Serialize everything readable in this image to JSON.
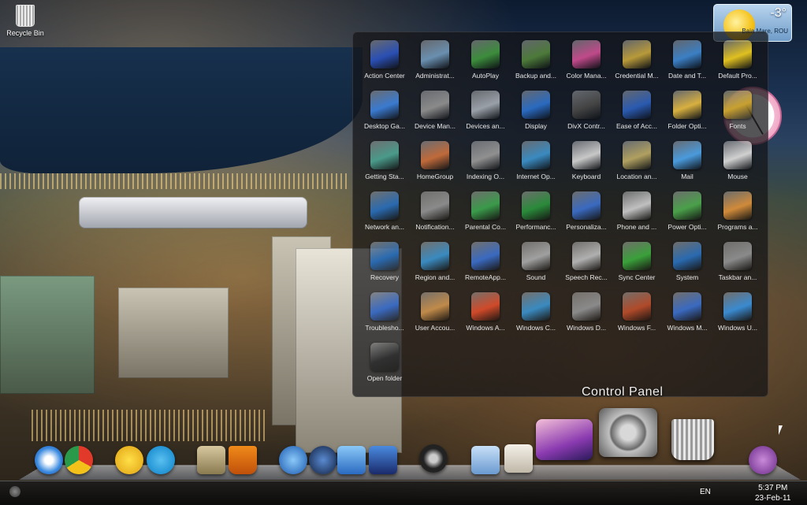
{
  "desktop": {
    "recycle_bin_label": "Recycle Bin"
  },
  "weather": {
    "temperature": "-3°",
    "location": "Baia Mare, ROU"
  },
  "control_panel": {
    "title": "Control Panel",
    "items": [
      {
        "label": "Action Center",
        "icon": "flag-icon",
        "color": "#2a4fb4"
      },
      {
        "label": "Administrat...",
        "icon": "folder-icon",
        "color": "#6a8fb0"
      },
      {
        "label": "AutoPlay",
        "icon": "autoplay-icon",
        "color": "#3c8c3c"
      },
      {
        "label": "Backup and...",
        "icon": "backup-icon",
        "color": "#4d7a3a"
      },
      {
        "label": "Color Mana...",
        "icon": "color-management-icon",
        "color": "#c04a8a"
      },
      {
        "label": "Credential M...",
        "icon": "vault-icon",
        "color": "#b89a3a"
      },
      {
        "label": "Date and T...",
        "icon": "calendar-clock-icon",
        "color": "#3b7fc4"
      },
      {
        "label": "Default Pro...",
        "icon": "default-programs-icon",
        "color": "#e0c020"
      },
      {
        "label": "Desktop Ga...",
        "icon": "gadgets-icon",
        "color": "#3a7ad0"
      },
      {
        "label": "Device Man...",
        "icon": "device-manager-icon",
        "color": "#8a8a8a"
      },
      {
        "label": "Devices an...",
        "icon": "printer-icon",
        "color": "#9aa0a8"
      },
      {
        "label": "Display",
        "icon": "monitor-icon",
        "color": "#2a6ac0"
      },
      {
        "label": "DivX Contr...",
        "icon": "divx-icon",
        "color": "#444444"
      },
      {
        "label": "Ease of Acc...",
        "icon": "accessibility-icon",
        "color": "#2a5ab0"
      },
      {
        "label": "Folder Opti...",
        "icon": "folder-options-icon",
        "color": "#d8b040"
      },
      {
        "label": "Fonts",
        "icon": "fonts-icon",
        "color": "#c8a030"
      },
      {
        "label": "Getting Sta...",
        "icon": "getting-started-icon",
        "color": "#4a9a8a"
      },
      {
        "label": "HomeGroup",
        "icon": "home-icon",
        "color": "#c06a3a"
      },
      {
        "label": "Indexing O...",
        "icon": "indexing-icon",
        "color": "#909090"
      },
      {
        "label": "Internet Op...",
        "icon": "globe-icon",
        "color": "#3a8ac0"
      },
      {
        "label": "Keyboard",
        "icon": "keyboard-icon",
        "color": "#c8c8c8"
      },
      {
        "label": "Location an...",
        "icon": "location-icon",
        "color": "#b0a060"
      },
      {
        "label": "Mail",
        "icon": "mail-icon",
        "color": "#4a9adc"
      },
      {
        "label": "Mouse",
        "icon": "mouse-icon",
        "color": "#d0d0d0"
      },
      {
        "label": "Network an...",
        "icon": "network-icon",
        "color": "#2a6ab0"
      },
      {
        "label": "Notification...",
        "icon": "notification-icon",
        "color": "#8a8a8a"
      },
      {
        "label": "Parental Co...",
        "icon": "parental-controls-icon",
        "color": "#3a9a4a"
      },
      {
        "label": "Performanc...",
        "icon": "performance-icon",
        "color": "#2a8a3a"
      },
      {
        "label": "Personaliza...",
        "icon": "personalization-icon",
        "color": "#3a6ac0"
      },
      {
        "label": "Phone and ...",
        "icon": "phone-icon",
        "color": "#c0c0c0"
      },
      {
        "label": "Power Opti...",
        "icon": "power-icon",
        "color": "#4aa04a"
      },
      {
        "label": "Programs a...",
        "icon": "programs-icon",
        "color": "#d08a3a"
      },
      {
        "label": "Recovery",
        "icon": "recovery-icon",
        "color": "#2a6ab0"
      },
      {
        "label": "Region and...",
        "icon": "region-icon",
        "color": "#3a8ac0"
      },
      {
        "label": "RemoteApp...",
        "icon": "remoteapp-icon",
        "color": "#3a6ac0"
      },
      {
        "label": "Sound",
        "icon": "speaker-icon",
        "color": "#a0a0a0"
      },
      {
        "label": "Speech Rec...",
        "icon": "microphone-icon",
        "color": "#b0b0b0"
      },
      {
        "label": "Sync Center",
        "icon": "sync-icon",
        "color": "#3aa03a"
      },
      {
        "label": "System",
        "icon": "system-icon",
        "color": "#2a6ab0"
      },
      {
        "label": "Taskbar an...",
        "icon": "taskbar-icon",
        "color": "#8a8a8a"
      },
      {
        "label": "Troublesho...",
        "icon": "troubleshooting-icon",
        "color": "#3a6ac0"
      },
      {
        "label": "User Accou...",
        "icon": "users-icon",
        "color": "#c08a4a"
      },
      {
        "label": "Windows A...",
        "icon": "windows-logo-icon",
        "color": "#d04a2a"
      },
      {
        "label": "Windows C...",
        "icon": "windows-cardspace-icon",
        "color": "#3a8ac0"
      },
      {
        "label": "Windows D...",
        "icon": "defender-icon",
        "color": "#8a8a8a"
      },
      {
        "label": "Windows F...",
        "icon": "firewall-icon",
        "color": "#b04a2a"
      },
      {
        "label": "Windows M...",
        "icon": "windows-mobility-icon",
        "color": "#3a6ac0"
      },
      {
        "label": "Windows U...",
        "icon": "windows-update-icon",
        "color": "#3a8ad0"
      },
      {
        "label": "Open folder",
        "icon": "open-folder-icon",
        "color": "#303030"
      }
    ]
  },
  "taskbar": {
    "language": "EN",
    "time": "5:37 PM",
    "date": "23-Feb-11"
  }
}
